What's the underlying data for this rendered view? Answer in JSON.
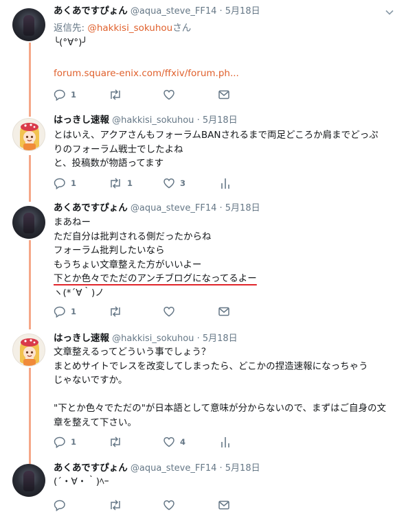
{
  "colors": {
    "accent": "#e0602c",
    "thread_line": "#f5a788",
    "underline": "#e0242a",
    "muted": "#657786"
  },
  "tweets": [
    {
      "name": "あくあですぴょん",
      "handle": "@aqua_steve_FF14",
      "dot": "·",
      "time": "5月18日",
      "reply_prefix": "返信先: ",
      "reply_mention": "@hakkisi_sokuhou",
      "reply_suffix": "さん",
      "lines": [
        "╰(°∀°)╯",
        ""
      ],
      "link": "forum.square-enix.com/ffxiv/forum.ph...",
      "counts": {
        "reply": "1",
        "retweet": "",
        "like": ""
      }
    },
    {
      "name": "はっきし速報",
      "handle": "@hakkisi_sokuhou",
      "dot": "·",
      "time": "5月18日",
      "lines": [
        "とはいえ、アクアさんもフォーラムBANされるまで両足どころか肩までどっぷ",
        "りのフォーラム戦士でしたよね",
        "と、投稿数が物語ってます"
      ],
      "counts": {
        "reply": "1",
        "retweet": "1",
        "like": "3"
      }
    },
    {
      "name": "あくあですぴょん",
      "handle": "@aqua_steve_FF14",
      "dot": "·",
      "time": "5月18日",
      "lines": [
        "まあねー",
        "ただ自分は批判される側だったからね",
        "フォーラム批判したいなら",
        "もうちょい文章整えた方がいいよー"
      ],
      "underlined_line": "下とか色々でただのアンチブログになってるよー",
      "last_line": "ヽ(*´∀｀)ノ",
      "counts": {
        "reply": "1",
        "retweet": "",
        "like": ""
      }
    },
    {
      "name": "はっきし速報",
      "handle": "@hakkisi_sokuhou",
      "dot": "·",
      "time": "5月18日",
      "lines": [
        "文章整えるってどういう事でしょう？",
        "まとめサイトでレスを改変してしまったら、どこかの捏造速報になっちゃう",
        "じゃないですか。",
        "",
        "\"下とか色々でただの\"が日本語として意味が分からないので、まずはご自身の文",
        "章を整えて下さい。"
      ],
      "counts": {
        "reply": "1",
        "retweet": "",
        "like": "4"
      }
    },
    {
      "name": "あくあですぴょん",
      "handle": "@aqua_steve_FF14",
      "dot": "·",
      "time": "5月18日",
      "lines": [
        "(´・∀・｀)ﾍｰ"
      ],
      "counts": {
        "reply": "",
        "retweet": "",
        "like": ""
      }
    }
  ]
}
